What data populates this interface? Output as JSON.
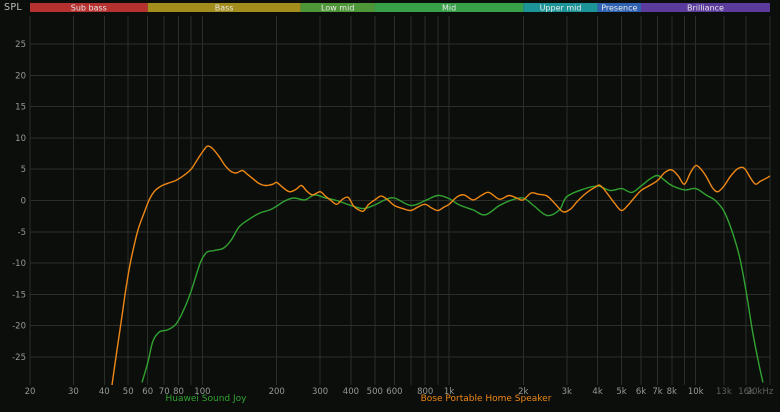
{
  "header": {
    "spl_label": "SPL"
  },
  "colors": {
    "background": "#0c0e0c",
    "grid": "#2b2f2a",
    "tick_label": "#949a94",
    "tick_label_dim": "#5c615c",
    "band_text": "#e9e9e9"
  },
  "bands": [
    {
      "label": "Sub bass",
      "color": "#b53230",
      "from": 20,
      "to": 60
    },
    {
      "label": "Bass",
      "color": "#a38d1c",
      "from": 60,
      "to": 250
    },
    {
      "label": "Low mid",
      "color": "#4e9738",
      "from": 250,
      "to": 500
    },
    {
      "label": "Mid",
      "color": "#37a049",
      "from": 500,
      "to": 2000
    },
    {
      "label": "Upper mid",
      "color": "#1d9598",
      "from": 2000,
      "to": 4000
    },
    {
      "label": "Presence",
      "color": "#2f62b2",
      "from": 4000,
      "to": 6000
    },
    {
      "label": "Brilliance",
      "color": "#5b3c9c",
      "from": 6000,
      "to": 20000
    }
  ],
  "axis": {
    "y_ticks": [
      25,
      20,
      15,
      10,
      5,
      0,
      -5,
      -10,
      -15,
      -20,
      -25
    ],
    "x_grid": [
      20,
      30,
      40,
      50,
      60,
      70,
      80,
      90,
      100,
      200,
      300,
      400,
      500,
      600,
      700,
      800,
      900,
      1000,
      2000,
      3000,
      4000,
      5000,
      6000,
      7000,
      8000,
      9000,
      10000,
      13000,
      16000,
      20000
    ],
    "x_ticks": [
      {
        "f": 20,
        "label": "20"
      },
      {
        "f": 30,
        "label": "30"
      },
      {
        "f": 40,
        "label": "40"
      },
      {
        "f": 50,
        "label": "50"
      },
      {
        "f": 60,
        "label": "60"
      },
      {
        "f": 70,
        "label": "70"
      },
      {
        "f": 80,
        "label": "80"
      },
      {
        "f": 100,
        "label": "100"
      },
      {
        "f": 200,
        "label": "200"
      },
      {
        "f": 300,
        "label": "300"
      },
      {
        "f": 400,
        "label": "400"
      },
      {
        "f": 500,
        "label": "500"
      },
      {
        "f": 600,
        "label": "600"
      },
      {
        "f": 800,
        "label": "800"
      },
      {
        "f": 1000,
        "label": "1k"
      },
      {
        "f": 2000,
        "label": "2k"
      },
      {
        "f": 3000,
        "label": "3k"
      },
      {
        "f": 4000,
        "label": "4k"
      },
      {
        "f": 5000,
        "label": "5k"
      },
      {
        "f": 6000,
        "label": "6k"
      },
      {
        "f": 7000,
        "label": "7k"
      },
      {
        "f": 8000,
        "label": "8k"
      },
      {
        "f": 10000,
        "label": "10k"
      },
      {
        "f": 13000,
        "label": "13k",
        "dim": true
      },
      {
        "f": 16000,
        "label": "16k",
        "dim": true
      },
      {
        "f": 20000,
        "label": "20kHz",
        "dim": true
      }
    ]
  },
  "chart_data": {
    "type": "line",
    "title": "",
    "xlabel": "",
    "ylabel": "SPL",
    "x_scale": "log",
    "xlim": [
      20,
      20000
    ],
    "ylim": [
      -29.5,
      29.5
    ],
    "grid": true,
    "legend_position": "bottom",
    "series": [
      {
        "name": "Huawei Sound Joy",
        "color": "#31a331",
        "points": [
          [
            57,
            -29
          ],
          [
            60,
            -26
          ],
          [
            63,
            -22.5
          ],
          [
            67,
            -21
          ],
          [
            72,
            -20.7
          ],
          [
            78,
            -19.8
          ],
          [
            84,
            -17.5
          ],
          [
            90,
            -14.5
          ],
          [
            98,
            -10
          ],
          [
            104,
            -8.3
          ],
          [
            112,
            -8.0
          ],
          [
            122,
            -7.6
          ],
          [
            131,
            -6.3
          ],
          [
            141,
            -4.2
          ],
          [
            156,
            -2.9
          ],
          [
            171,
            -2.0
          ],
          [
            188,
            -1.5
          ],
          [
            200,
            -0.9
          ],
          [
            215,
            -0.1
          ],
          [
            235,
            0.4
          ],
          [
            260,
            0.1
          ],
          [
            285,
            0.9
          ],
          [
            315,
            0.4
          ],
          [
            350,
            0.0
          ],
          [
            400,
            -0.8
          ],
          [
            450,
            -1.3
          ],
          [
            500,
            -0.7
          ],
          [
            550,
            0.1
          ],
          [
            600,
            0.4
          ],
          [
            700,
            -0.8
          ],
          [
            800,
            0.0
          ],
          [
            900,
            0.8
          ],
          [
            1000,
            0.3
          ],
          [
            1100,
            -0.7
          ],
          [
            1250,
            -1.5
          ],
          [
            1400,
            -2.3
          ],
          [
            1600,
            -0.8
          ],
          [
            1800,
            0.1
          ],
          [
            2000,
            0.4
          ],
          [
            2200,
            -0.8
          ],
          [
            2500,
            -2.4
          ],
          [
            2800,
            -1.5
          ],
          [
            3000,
            0.6
          ],
          [
            3500,
            1.8
          ],
          [
            4000,
            2.3
          ],
          [
            4500,
            1.6
          ],
          [
            5000,
            1.9
          ],
          [
            5500,
            1.3
          ],
          [
            6000,
            2.3
          ],
          [
            6500,
            3.4
          ],
          [
            7000,
            4.0
          ],
          [
            7500,
            3.2
          ],
          [
            8000,
            2.4
          ],
          [
            9000,
            1.7
          ],
          [
            10000,
            1.9
          ],
          [
            11000,
            0.9
          ],
          [
            12000,
            0.0
          ],
          [
            13000,
            -1.7
          ],
          [
            14000,
            -4.8
          ],
          [
            15000,
            -8.8
          ],
          [
            16000,
            -14.5
          ],
          [
            17000,
            -21
          ],
          [
            18000,
            -26
          ],
          [
            18700,
            -29
          ]
        ]
      },
      {
        "name": "Bose Portable Home Speaker",
        "color": "#ef8815",
        "points": [
          [
            43,
            -29.5
          ],
          [
            45,
            -24
          ],
          [
            47,
            -19
          ],
          [
            49,
            -14
          ],
          [
            51,
            -10
          ],
          [
            53,
            -7
          ],
          [
            55,
            -4.5
          ],
          [
            58,
            -2
          ],
          [
            61,
            0.2
          ],
          [
            64,
            1.5
          ],
          [
            68,
            2.3
          ],
          [
            73,
            2.8
          ],
          [
            78,
            3.2
          ],
          [
            84,
            4.0
          ],
          [
            90,
            5.0
          ],
          [
            96,
            6.7
          ],
          [
            101,
            8.0
          ],
          [
            105,
            8.7
          ],
          [
            110,
            8.3
          ],
          [
            117,
            7.0
          ],
          [
            123,
            5.7
          ],
          [
            130,
            4.7
          ],
          [
            137,
            4.4
          ],
          [
            145,
            4.8
          ],
          [
            152,
            4.2
          ],
          [
            160,
            3.5
          ],
          [
            170,
            2.7
          ],
          [
            180,
            2.4
          ],
          [
            193,
            2.6
          ],
          [
            200,
            2.9
          ],
          [
            210,
            2.2
          ],
          [
            225,
            1.4
          ],
          [
            240,
            1.8
          ],
          [
            252,
            2.4
          ],
          [
            265,
            1.5
          ],
          [
            280,
            0.9
          ],
          [
            300,
            1.4
          ],
          [
            315,
            0.7
          ],
          [
            330,
            0.1
          ],
          [
            350,
            -0.6
          ],
          [
            370,
            0.2
          ],
          [
            390,
            0.5
          ],
          [
            410,
            -0.9
          ],
          [
            430,
            -1.5
          ],
          [
            450,
            -1.7
          ],
          [
            470,
            -0.7
          ],
          [
            500,
            0.1
          ],
          [
            530,
            0.7
          ],
          [
            560,
            0.2
          ],
          [
            600,
            -0.8
          ],
          [
            650,
            -1.3
          ],
          [
            700,
            -1.6
          ],
          [
            750,
            -1.0
          ],
          [
            800,
            -0.6
          ],
          [
            850,
            -1.2
          ],
          [
            900,
            -1.6
          ],
          [
            950,
            -1.1
          ],
          [
            1000,
            -0.6
          ],
          [
            1080,
            0.6
          ],
          [
            1150,
            0.9
          ],
          [
            1250,
            0.1
          ],
          [
            1350,
            0.8
          ],
          [
            1450,
            1.3
          ],
          [
            1600,
            0.2
          ],
          [
            1750,
            0.8
          ],
          [
            1900,
            0.3
          ],
          [
            2000,
            0.1
          ],
          [
            2150,
            1.2
          ],
          [
            2300,
            1.0
          ],
          [
            2500,
            0.7
          ],
          [
            2700,
            -0.6
          ],
          [
            2900,
            -1.8
          ],
          [
            3100,
            -1.4
          ],
          [
            3300,
            -0.2
          ],
          [
            3600,
            1.2
          ],
          [
            3900,
            2.1
          ],
          [
            4100,
            2.4
          ],
          [
            4400,
            1.0
          ],
          [
            4700,
            -0.5
          ],
          [
            5000,
            -1.6
          ],
          [
            5300,
            -0.8
          ],
          [
            5600,
            0.3
          ],
          [
            6000,
            1.6
          ],
          [
            6500,
            2.4
          ],
          [
            7000,
            3.2
          ],
          [
            7500,
            4.5
          ],
          [
            8000,
            4.9
          ],
          [
            8500,
            3.9
          ],
          [
            9000,
            2.6
          ],
          [
            9500,
            4.4
          ],
          [
            10000,
            5.6
          ],
          [
            10500,
            5.0
          ],
          [
            11000,
            3.9
          ],
          [
            11700,
            2.0
          ],
          [
            12300,
            1.4
          ],
          [
            13000,
            2.3
          ],
          [
            13800,
            3.8
          ],
          [
            14700,
            5.0
          ],
          [
            15500,
            5.3
          ],
          [
            16000,
            4.8
          ],
          [
            16800,
            3.4
          ],
          [
            17500,
            2.6
          ],
          [
            18300,
            3.1
          ],
          [
            19000,
            3.4
          ],
          [
            20000,
            3.9
          ]
        ]
      }
    ]
  }
}
